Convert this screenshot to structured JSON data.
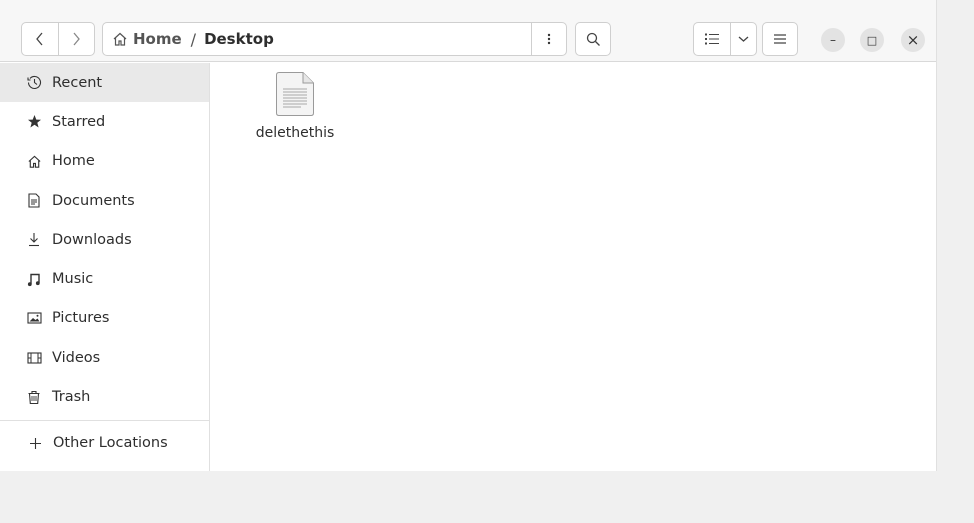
{
  "window": {
    "nav": {
      "back_icon": "chevron-left-icon",
      "forward_icon": "chevron-right-icon"
    },
    "path": {
      "home_label": "Home",
      "separator": "/",
      "current": "Desktop"
    },
    "toolbar": {
      "path_menu_icon": "kebab-menu-icon",
      "search_icon": "search-icon",
      "view_icon": "list-view-icon",
      "view_dropdown_icon": "chevron-down-icon",
      "main_menu_icon": "hamburger-menu-icon"
    },
    "controls": {
      "minimize": "–",
      "maximize": "□",
      "close": "×"
    }
  },
  "sidebar": {
    "items": [
      {
        "label": "Recent",
        "icon": "clock-icon",
        "active": true
      },
      {
        "label": "Starred",
        "icon": "star-icon"
      },
      {
        "label": "Home",
        "icon": "home-icon"
      },
      {
        "label": "Documents",
        "icon": "document-icon"
      },
      {
        "label": "Downloads",
        "icon": "download-icon"
      },
      {
        "label": "Music",
        "icon": "music-icon"
      },
      {
        "label": "Pictures",
        "icon": "picture-icon"
      },
      {
        "label": "Videos",
        "icon": "video-icon"
      },
      {
        "label": "Trash",
        "icon": "trash-icon"
      }
    ],
    "other_locations": {
      "label": "Other Locations",
      "icon": "plus-icon"
    }
  },
  "content": {
    "files": [
      {
        "name": "delethethis",
        "icon": "text-file-icon"
      }
    ]
  }
}
